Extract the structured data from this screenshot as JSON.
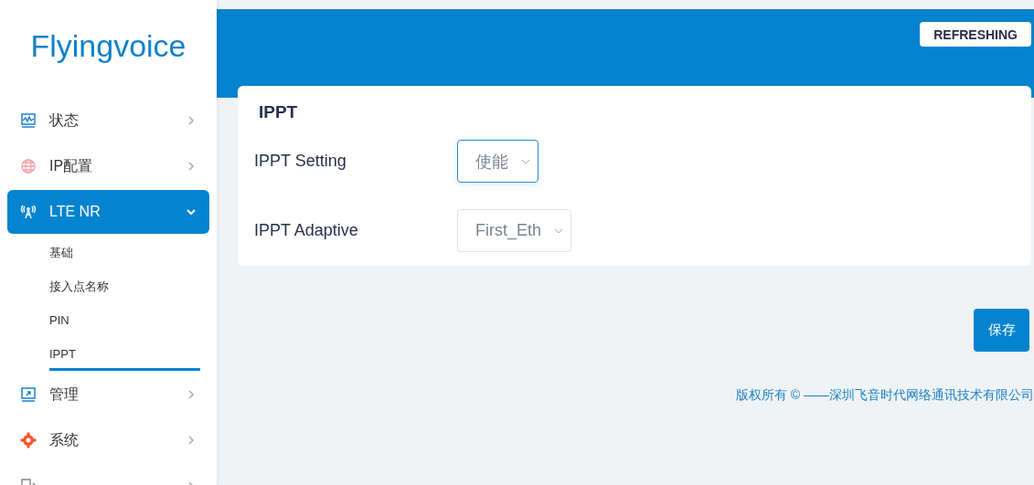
{
  "brand": "Flyingvoice",
  "sidebar": {
    "items": [
      {
        "label": "状态",
        "selected": false,
        "expanded": false
      },
      {
        "label": "IP配置",
        "selected": false,
        "expanded": false
      },
      {
        "label": "LTE NR",
        "selected": true,
        "expanded": true,
        "children": [
          {
            "label": "基础",
            "selected": false
          },
          {
            "label": "接入点名称",
            "selected": false
          },
          {
            "label": "PIN",
            "selected": false
          },
          {
            "label": "IPPT",
            "selected": true
          }
        ]
      },
      {
        "label": "管理",
        "selected": false,
        "expanded": false
      },
      {
        "label": "系统",
        "selected": false,
        "expanded": false
      },
      {
        "selected": false,
        "expanded": false
      }
    ]
  },
  "header": {
    "refresh_button": "REFRESHING"
  },
  "card": {
    "title": "IPPT",
    "fields": [
      {
        "label": "IPPT Setting",
        "value": "使能",
        "focused": true
      },
      {
        "label": "IPPT Adaptive",
        "value": "First_Eth",
        "focused": false
      }
    ]
  },
  "save_button": "保存",
  "footer": "版权所有 © ——深圳飞音时代网络通讯技术有限公司"
}
